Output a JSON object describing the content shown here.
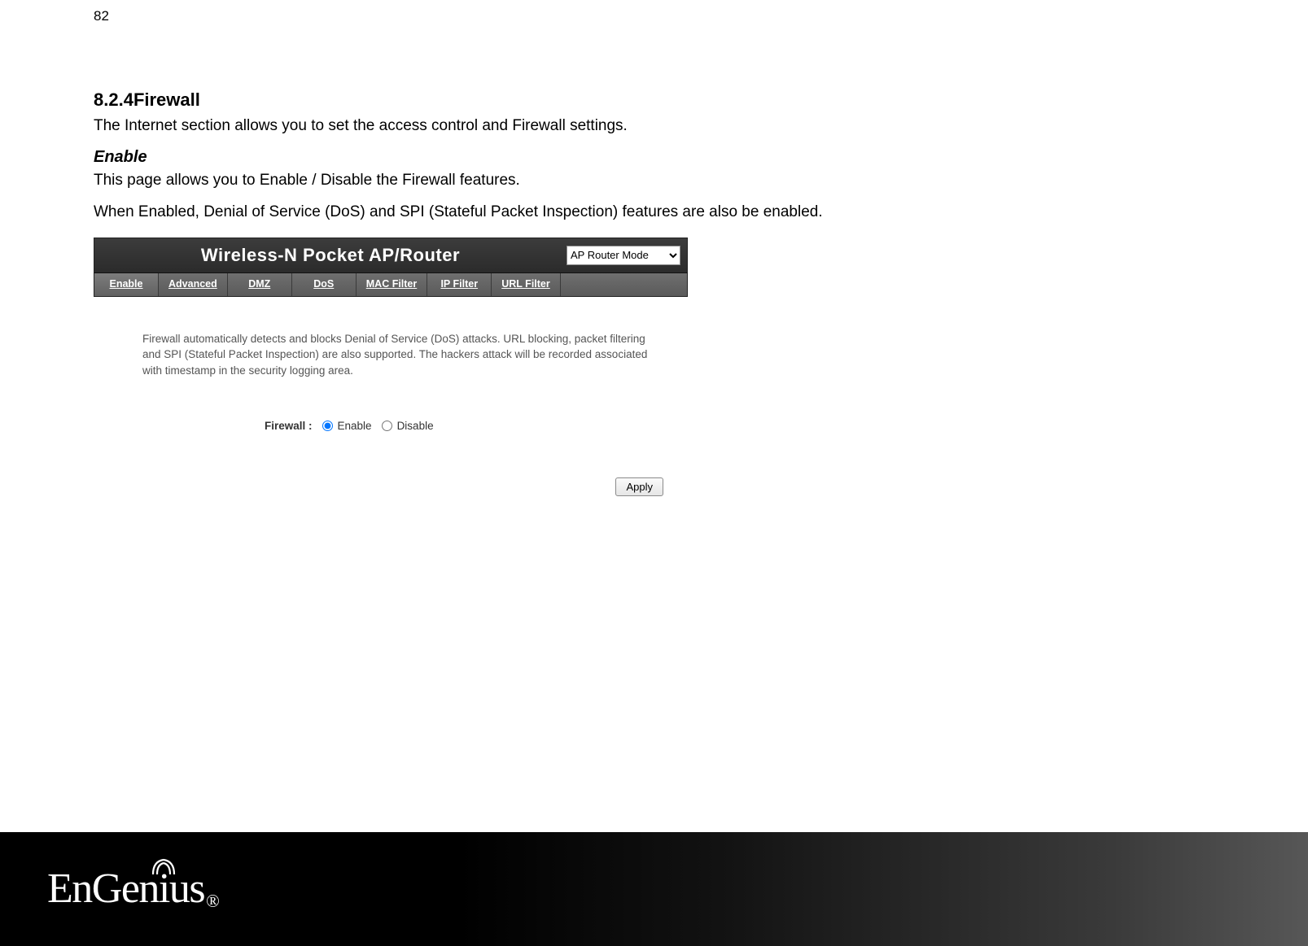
{
  "page_number": "82",
  "section": {
    "number": "8.2.4",
    "title": "Firewall"
  },
  "intro": "The Internet section allows you to set the access control and Firewall settings.",
  "sub_heading": "Enable",
  "sub_body_1": "This page allows you to Enable / Disable the Firewall features.",
  "sub_body_2": "When Enabled, Denial of Service (DoS) and SPI (Stateful Packet Inspection) features are also be enabled.",
  "shot": {
    "title": "Wireless-N Pocket AP/Router",
    "mode_select": "AP Router Mode",
    "tabs": [
      "Enable",
      "Advanced",
      "DMZ",
      "DoS",
      "MAC Filter",
      "IP Filter",
      "URL Filter"
    ],
    "desc": "Firewall automatically detects and blocks Denial of Service (DoS) attacks. URL blocking, packet filtering and SPI (Stateful Packet Inspection) are also supported. The hackers attack will be recorded associated with timestamp in the security logging area.",
    "form": {
      "label": "Firewall :",
      "opt_enable": "Enable",
      "opt_disable": "Disable",
      "selected": "enable"
    },
    "apply": "Apply"
  },
  "brand": {
    "name": "EnGenius",
    "reg": "®"
  }
}
